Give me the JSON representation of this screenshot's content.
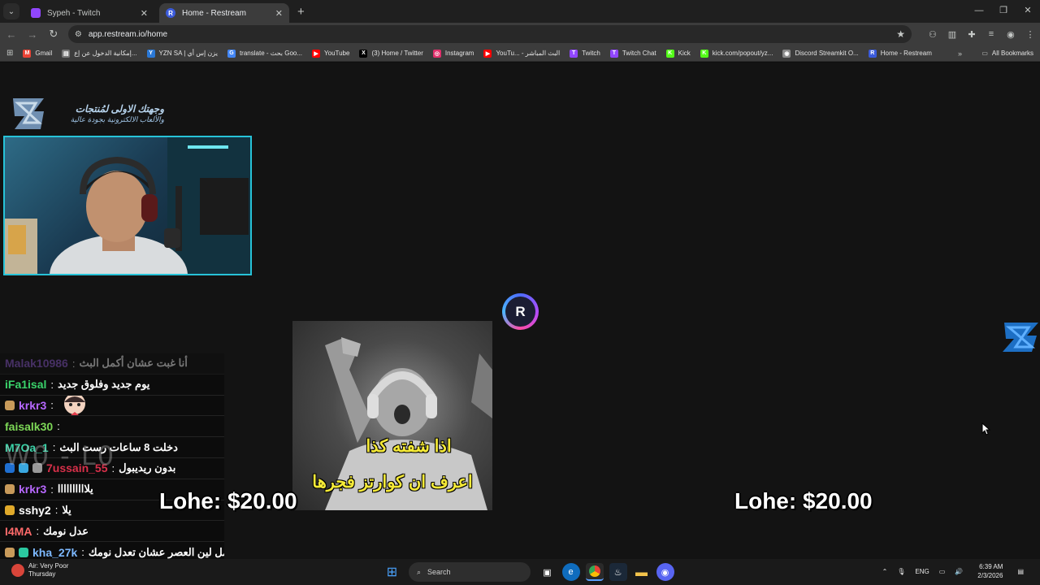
{
  "browser": {
    "tabs": [
      {
        "title": "Sypeh - Twitch",
        "active": false,
        "favicon_color": "#9146ff",
        "favicon": "twitch-icon"
      },
      {
        "title": "Home - Restream",
        "active": true,
        "favicon_color": "#3b5bdb",
        "favicon": "restream-icon",
        "favicon_letter": "R"
      }
    ],
    "url": "app.restream.io/home",
    "bookmarks": [
      {
        "label": "Gmail",
        "icon": "gmail-icon",
        "color": "#ea4335",
        "glyph": "M"
      },
      {
        "label": "إمكانية الدخول عن إع...",
        "icon": "page-icon",
        "color": "#777777",
        "glyph": "▤"
      },
      {
        "label": "YZN SA | يزن إس أي",
        "icon": "yzn-icon",
        "color": "#2a78d6",
        "glyph": "Y"
      },
      {
        "label": "translate - بحث Goo...",
        "icon": "google-icon",
        "color": "#4285f4",
        "glyph": "G"
      },
      {
        "label": "YouTube",
        "icon": "youtube-icon",
        "color": "#ff0000",
        "glyph": "▶"
      },
      {
        "label": "(3) Home / Twitter",
        "icon": "x-icon",
        "color": "#000000",
        "glyph": "X"
      },
      {
        "label": "Instagram",
        "icon": "instagram-icon",
        "color": "#e1306c",
        "glyph": "◎"
      },
      {
        "label": "YouTu... - البث المباشر",
        "icon": "youtube-icon",
        "color": "#ff0000",
        "glyph": "▶"
      },
      {
        "label": "Twitch",
        "icon": "twitch-icon",
        "color": "#9146ff",
        "glyph": "T"
      },
      {
        "label": "Twitch Chat",
        "icon": "twitch-icon",
        "color": "#9146ff",
        "glyph": "T"
      },
      {
        "label": "Kick",
        "icon": "kick-icon",
        "color": "#53fc18",
        "glyph": "K"
      },
      {
        "label": "kick.com/popout/yz...",
        "icon": "kick-icon",
        "color": "#53fc18",
        "glyph": "K"
      },
      {
        "label": "Discord Streamkit O...",
        "icon": "discord-icon",
        "color": "#8a8a8a",
        "glyph": "◉"
      },
      {
        "label": "Home - Restream",
        "icon": "restream-icon",
        "color": "#3b5bdb",
        "glyph": "R"
      }
    ],
    "all_bookmarks": "All Bookmarks",
    "more": "»"
  },
  "stream": {
    "logo_line1": "وجهتك الاولى لمُنتجات",
    "logo_line2": "والألعاب الالكترونية بجودة عالية",
    "restream_letter": "R",
    "meme_caption1": "اذا شفته كذا",
    "meme_caption2": "اعرف ان كوارتز فجرها",
    "overlay_wl": "W0 - L0",
    "donation_left": "Lohe: $20.00",
    "donation_right": "Lohe: $20.00"
  },
  "chat": [
    {
      "user": "Malak10986",
      "color": "#8f5ad7",
      "text": "أنا غبت عشان أكمل البث",
      "badges": [],
      "faded": true
    },
    {
      "user": "iFa1isal",
      "color": "#3ad36b",
      "text": "يوم جديد وفلوق جديد",
      "badges": []
    },
    {
      "user": "krkr3",
      "color": "#b768ff",
      "text": "",
      "badges": [
        "#c89a5a"
      ],
      "emote": true
    },
    {
      "user": "faisalk30",
      "color": "#7dd857",
      "text": "",
      "badges": []
    },
    {
      "user": "M7Oa_1",
      "color": "#3ad3a8",
      "text": "دخلت 8 ساعات رست البث",
      "badges": []
    },
    {
      "user": "7ussain_55",
      "color": "#d9304a",
      "text": "بدون ريديبول",
      "badges": [
        "#1f6fd1",
        "#3aa8e0",
        "#999999"
      ]
    },
    {
      "user": "krkr3",
      "color": "#b768ff",
      "text": "يلاااااااااا",
      "badges": [
        "#c89a5a"
      ]
    },
    {
      "user": "sshy2",
      "color": "#ffffff",
      "text": "يلا",
      "badges": [
        "#e0a92a"
      ]
    },
    {
      "user": "I4MA",
      "color": "#ff6a6a",
      "text": "عدل نومك",
      "badges": []
    },
    {
      "user": "kha_27k",
      "color": "#7db9ff",
      "text": "اصمل لين العصر عشان تعدل نومك",
      "badges": [
        "#c89a5a",
        "#2bc8a0"
      ]
    }
  ],
  "taskbar": {
    "weather_label": "Air: Very Poor",
    "weather_day": "Thursday",
    "search": "Search",
    "lang": "ENG",
    "time": "6:39 AM",
    "date": "2/3/2026"
  }
}
